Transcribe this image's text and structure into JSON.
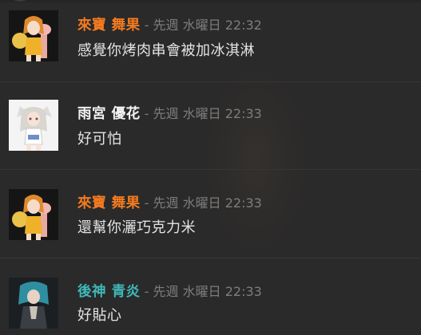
{
  "colors": {
    "background": "#2a2a2a",
    "divider": "#363636",
    "message_text": "#e4e4e4",
    "meta_text": "#7d7d7d"
  },
  "messages": [
    {
      "author": "來寶 舞果",
      "author_color": "#f47b20",
      "meta": " - 先週 水曜日 22:32",
      "text": "感覺你烤肉串會被加冰淇淋",
      "avatar_icon": "orange-hair-character-avatar"
    },
    {
      "author": "雨宮 優花",
      "author_color": "#f2f2f2",
      "meta": " - 先週 水曜日 22:33",
      "text": "好可怕",
      "avatar_icon": "white-hair-character-avatar"
    },
    {
      "author": "來寶 舞果",
      "author_color": "#f47b20",
      "meta": " - 先週 水曜日 22:33",
      "text": "還幫你灑巧克力米",
      "avatar_icon": "orange-hair-character-avatar"
    },
    {
      "author": "後神 青炎",
      "author_color": "#3fb8b8",
      "meta": " - 先週 水曜日 22:33",
      "text": "好貼心",
      "avatar_icon": "teal-hair-character-avatar"
    }
  ]
}
